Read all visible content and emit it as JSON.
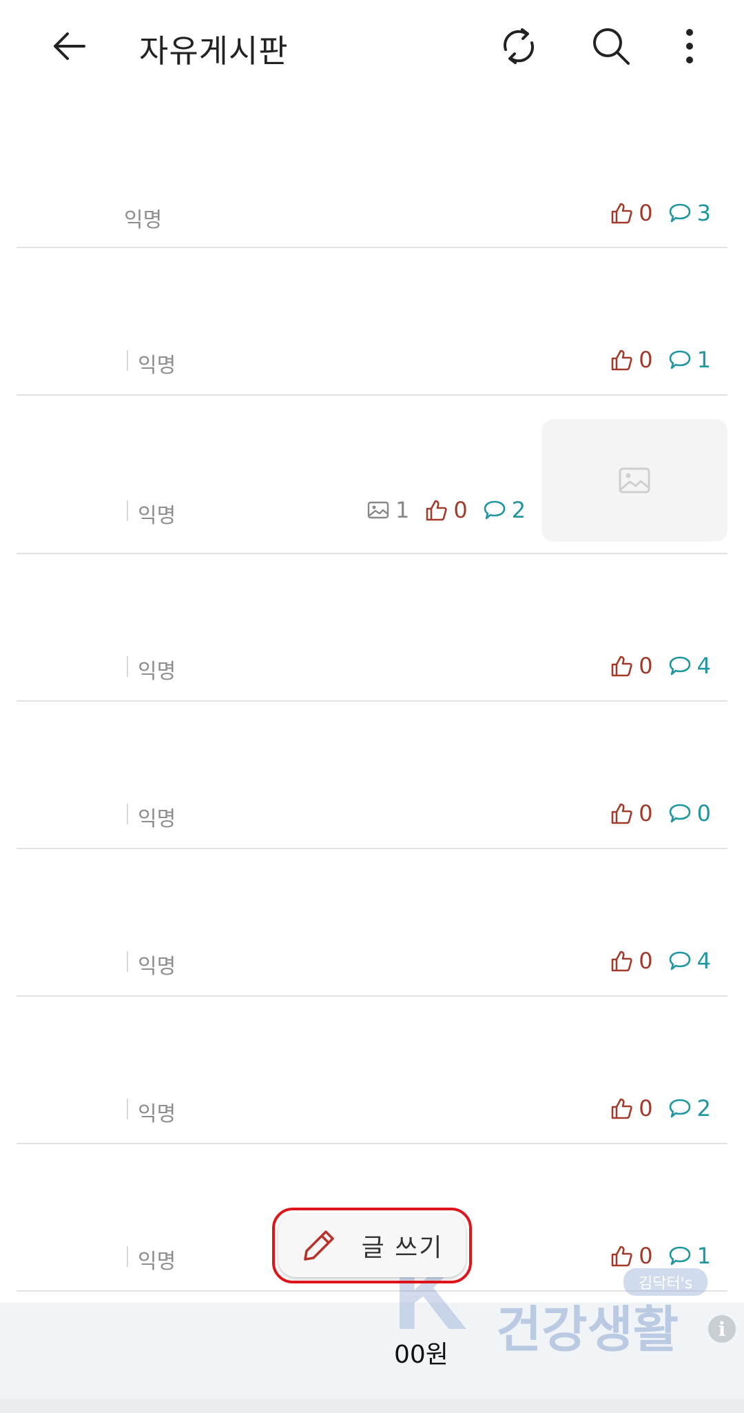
{
  "app_bar": {
    "title": "자유게시판",
    "back_icon": "arrow-left-icon",
    "refresh_icon": "refresh-icon",
    "search_icon": "search-icon",
    "more_icon": "more-vertical-icon"
  },
  "posts": [
    {
      "author": "익명",
      "likes": "0",
      "comments": "3"
    },
    {
      "author": "익명",
      "likes": "0",
      "comments": "1"
    },
    {
      "author": "익명",
      "images": "1",
      "likes": "0",
      "comments": "2"
    },
    {
      "author": "익명",
      "likes": "0",
      "comments": "4"
    },
    {
      "author": "익명",
      "likes": "0",
      "comments": "0"
    },
    {
      "author": "익명",
      "likes": "0",
      "comments": "4"
    },
    {
      "author": "익명",
      "likes": "0",
      "comments": "2"
    },
    {
      "author": "익명",
      "likes": "0",
      "comments": "1"
    }
  ],
  "write_button": {
    "label": "글 쓰기",
    "icon": "pencil-icon"
  },
  "ad": {
    "text": "00원",
    "info": "i"
  },
  "watermark": {
    "letter": "K",
    "tag": "김닥터's",
    "text": "건강생활"
  },
  "colors": {
    "like": "#a23a2b",
    "comment": "#1e96a0",
    "highlight": "#e0151b"
  }
}
